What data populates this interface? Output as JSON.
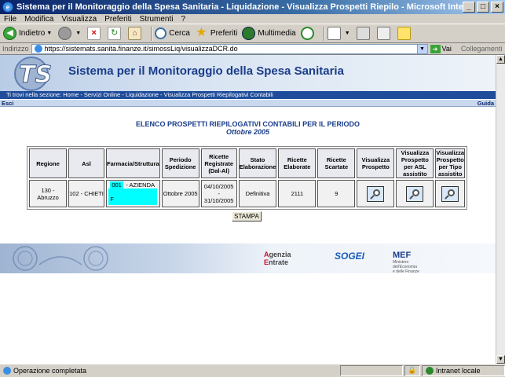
{
  "window": {
    "title": "Sistema per il Monitoraggio della Spesa Sanitaria - Liquidazione - Visualizza Prospetti Riepilo - Microsoft Internet Explorer"
  },
  "menu": [
    "File",
    "Modifica",
    "Visualizza",
    "Preferiti",
    "Strumenti",
    "?"
  ],
  "toolbar": {
    "back": "Indietro",
    "search": "Cerca",
    "favorites": "Preferiti",
    "media": "Multimedia"
  },
  "address": {
    "label": "Indirizzo",
    "url": "https://sistemats.sanita.finanze.it/simossLiq/visualizzaDCR.do",
    "go": "Vai",
    "links": "Collegamenti"
  },
  "site": {
    "title": "Sistema per il Monitoraggio della Spesa Sanitaria",
    "breadcrumb": "Ti trovi nella sezione: Home - Servizi Online - Liquidazione - Visualizza Prospetti Riepilogativi Contabili",
    "exit": "Esci",
    "guide": "Guida"
  },
  "report": {
    "title": "ELENCO PROSPETTI RIEPILOGATIVI CONTABILI PER IL PERIODO",
    "period": "Ottobre 2005",
    "headers": [
      "Regione",
      "Asl",
      "Farmacia/Struttura",
      "Periodo Spedizione",
      "Ricette Registrate (Dal-Al)",
      "Stato Elaborazione",
      "Ricette Elaborate",
      "Ricette Scartate",
      "Visualizza Prospetto",
      "Visualizza Prospetto per ASL assistito",
      "Visualizza Prospetto per Tipo assistito"
    ],
    "row": {
      "regione": "130 - Abruzzo",
      "asl": "102 - CHIETI",
      "farmacia_code": "001",
      "farmacia_name": "- AZIENDA",
      "farmacia_r": "F",
      "periodo": "Ottobre 2005",
      "ricette_dal": "04/10/2005",
      "ricette_sep": "-",
      "ricette_al": "31/10/2005",
      "stato": "Definitiva",
      "elaborate": "2111",
      "scartate": "9"
    },
    "print_button": "STAMPA"
  },
  "footer": {
    "agenzia_prefix": "A",
    "agenzia_top": "genzia",
    "agenzia_bottom": "ntrate",
    "sogei": "SOGEI",
    "mef": "MEF",
    "mef_sub1": "Ministero",
    "mef_sub2": "dell'Economia",
    "mef_sub3": "e delle Finanze"
  },
  "status": {
    "text": "Operazione completata",
    "zone": "Intranet locale"
  }
}
